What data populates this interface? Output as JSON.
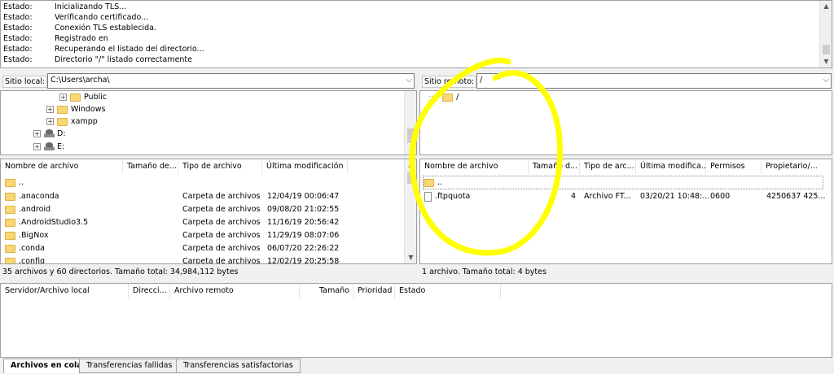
{
  "log": {
    "label": "Estado:",
    "messages": [
      "Inicializando TLS...",
      "Verificando certificado...",
      "Conexión TLS establecida.",
      "Registrado en",
      "Recuperando el listado del directorio...",
      "Directorio \"/\" listado correctamente"
    ]
  },
  "local": {
    "site_label": "Sitio local:",
    "path": "C:\\Users\\archa\\",
    "tree": [
      {
        "label": "Public",
        "expander": "+"
      },
      {
        "label": "Windows",
        "expander": "+"
      },
      {
        "label": "xampp",
        "expander": "+"
      },
      {
        "label": "D:",
        "expander": "+"
      },
      {
        "label": "E:",
        "expander": "+"
      }
    ],
    "columns": [
      "Nombre de archivo",
      "Tamaño de...",
      "Tipo de archivo",
      "Última modificación"
    ],
    "files": [
      {
        "name": "..",
        "type": "",
        "modified": ""
      },
      {
        "name": ".anaconda",
        "type": "Carpeta de archivos",
        "modified": "12/04/19 00:06:47"
      },
      {
        "name": ".android",
        "type": "Carpeta de archivos",
        "modified": "09/08/20 21:02:55"
      },
      {
        "name": ".AndroidStudio3.5",
        "type": "Carpeta de archivos",
        "modified": "11/16/19 20:56:42"
      },
      {
        "name": ".BigNox",
        "type": "Carpeta de archivos",
        "modified": "11/29/19 08:07:06"
      },
      {
        "name": ".conda",
        "type": "Carpeta de archivos",
        "modified": "06/07/20 22:26:22"
      },
      {
        "name": ".config",
        "type": "Carpeta de archivos",
        "modified": "12/02/19 20:25:58"
      }
    ],
    "status": "35 archivos y 60 directorios. Tamaño total: 34,984,112 bytes"
  },
  "remote": {
    "site_label": "Sitio remoto:",
    "path": "/",
    "tree_root": "/",
    "columns": [
      "Nombre de archivo",
      "Tamaño d...",
      "Tipo de arc...",
      "Última modifica...",
      "Permisos",
      "Propietario/..."
    ],
    "files": [
      {
        "name": "..",
        "size": "",
        "type": "",
        "modified": "",
        "perms": "",
        "owner": ""
      },
      {
        "name": ".ftpquota",
        "size": "4",
        "type": "Archivo FT...",
        "modified": "03/20/21 10:48:...",
        "perms": "0600",
        "owner": "4250637 425..."
      }
    ],
    "status": "1 archivo. Tamaño total: 4 bytes"
  },
  "queue": {
    "columns": [
      "Servidor/Archivo local",
      "Direcci...",
      "Archivo remoto",
      "Tamaño",
      "Prioridad",
      "Estado"
    ]
  },
  "tabs": [
    "Archivos en cola",
    "Transferencias fallidas",
    "Transferencias satisfactorias"
  ],
  "colors": {
    "annotation": "#ffff00",
    "folder": "#f8d775"
  }
}
